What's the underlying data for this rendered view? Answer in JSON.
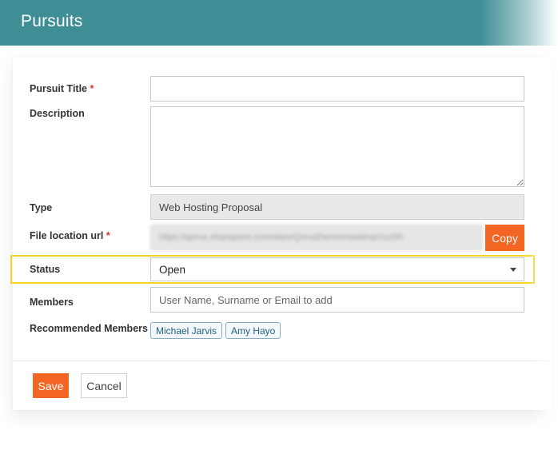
{
  "header": {
    "title": "Pursuits"
  },
  "form": {
    "pursuit_title": {
      "label": "Pursuit Title",
      "required_mark": "*",
      "value": ""
    },
    "description": {
      "label": "Description",
      "value": ""
    },
    "type": {
      "label": "Type",
      "value": "Web Hosting Proposal"
    },
    "file_location": {
      "label": "File location url",
      "required_mark": "*",
      "value": "https://qorus.sharepoint.com/sites/QorusDemos/webinar/cu/Sh",
      "copy_label": "Copy"
    },
    "status": {
      "label": "Status",
      "selected": "Open"
    },
    "members": {
      "label": "Members",
      "placeholder": "User Name, Surname or Email to add"
    },
    "recommended_members": {
      "label": "Recommended Members",
      "items": [
        "Michael Jarvis",
        "Amy Hayo"
      ]
    }
  },
  "actions": {
    "save_label": "Save",
    "cancel_label": "Cancel"
  },
  "colors": {
    "header_bg": "#3f8e96",
    "accent": "#f26522",
    "highlight": "#f5d327",
    "chip_text": "#1f5f86"
  }
}
